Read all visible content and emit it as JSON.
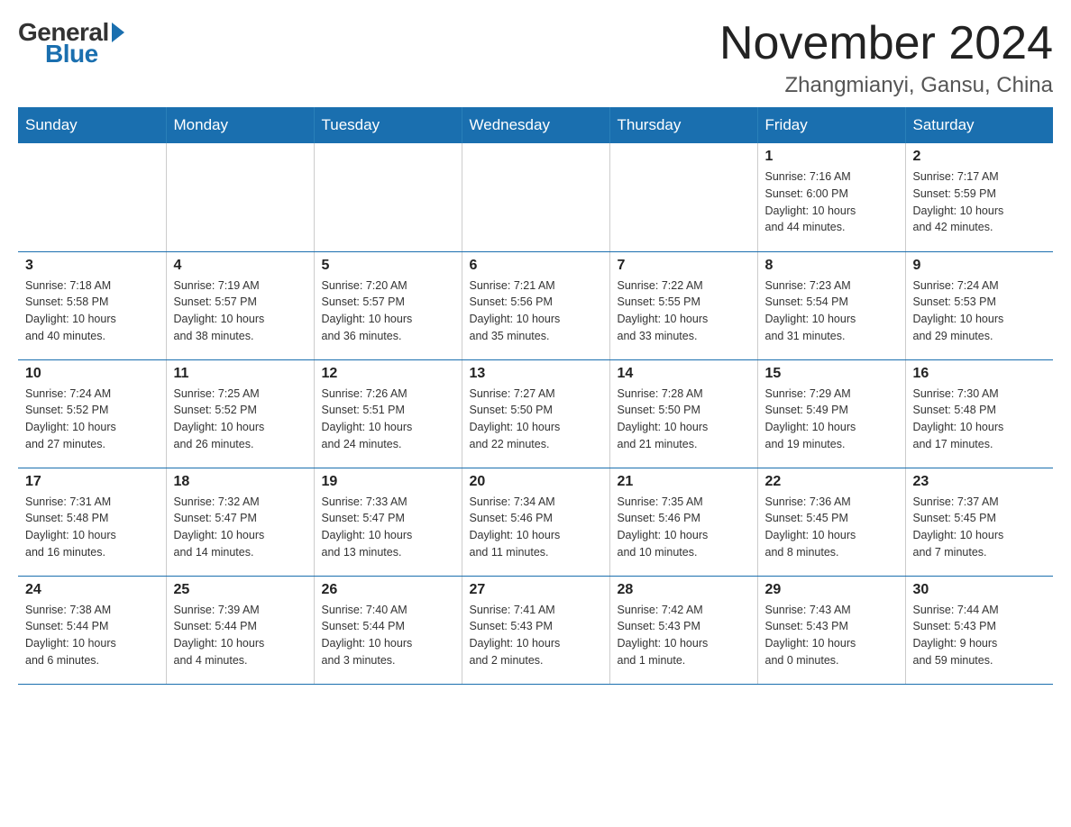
{
  "header": {
    "logo": {
      "general": "General",
      "blue": "Blue",
      "arrow": "▶"
    },
    "title": "November 2024",
    "location": "Zhangmianyi, Gansu, China"
  },
  "weekdays": [
    "Sunday",
    "Monday",
    "Tuesday",
    "Wednesday",
    "Thursday",
    "Friday",
    "Saturday"
  ],
  "weeks": [
    [
      {
        "day": "",
        "info": ""
      },
      {
        "day": "",
        "info": ""
      },
      {
        "day": "",
        "info": ""
      },
      {
        "day": "",
        "info": ""
      },
      {
        "day": "",
        "info": ""
      },
      {
        "day": "1",
        "info": "Sunrise: 7:16 AM\nSunset: 6:00 PM\nDaylight: 10 hours\nand 44 minutes."
      },
      {
        "day": "2",
        "info": "Sunrise: 7:17 AM\nSunset: 5:59 PM\nDaylight: 10 hours\nand 42 minutes."
      }
    ],
    [
      {
        "day": "3",
        "info": "Sunrise: 7:18 AM\nSunset: 5:58 PM\nDaylight: 10 hours\nand 40 minutes."
      },
      {
        "day": "4",
        "info": "Sunrise: 7:19 AM\nSunset: 5:57 PM\nDaylight: 10 hours\nand 38 minutes."
      },
      {
        "day": "5",
        "info": "Sunrise: 7:20 AM\nSunset: 5:57 PM\nDaylight: 10 hours\nand 36 minutes."
      },
      {
        "day": "6",
        "info": "Sunrise: 7:21 AM\nSunset: 5:56 PM\nDaylight: 10 hours\nand 35 minutes."
      },
      {
        "day": "7",
        "info": "Sunrise: 7:22 AM\nSunset: 5:55 PM\nDaylight: 10 hours\nand 33 minutes."
      },
      {
        "day": "8",
        "info": "Sunrise: 7:23 AM\nSunset: 5:54 PM\nDaylight: 10 hours\nand 31 minutes."
      },
      {
        "day": "9",
        "info": "Sunrise: 7:24 AM\nSunset: 5:53 PM\nDaylight: 10 hours\nand 29 minutes."
      }
    ],
    [
      {
        "day": "10",
        "info": "Sunrise: 7:24 AM\nSunset: 5:52 PM\nDaylight: 10 hours\nand 27 minutes."
      },
      {
        "day": "11",
        "info": "Sunrise: 7:25 AM\nSunset: 5:52 PM\nDaylight: 10 hours\nand 26 minutes."
      },
      {
        "day": "12",
        "info": "Sunrise: 7:26 AM\nSunset: 5:51 PM\nDaylight: 10 hours\nand 24 minutes."
      },
      {
        "day": "13",
        "info": "Sunrise: 7:27 AM\nSunset: 5:50 PM\nDaylight: 10 hours\nand 22 minutes."
      },
      {
        "day": "14",
        "info": "Sunrise: 7:28 AM\nSunset: 5:50 PM\nDaylight: 10 hours\nand 21 minutes."
      },
      {
        "day": "15",
        "info": "Sunrise: 7:29 AM\nSunset: 5:49 PM\nDaylight: 10 hours\nand 19 minutes."
      },
      {
        "day": "16",
        "info": "Sunrise: 7:30 AM\nSunset: 5:48 PM\nDaylight: 10 hours\nand 17 minutes."
      }
    ],
    [
      {
        "day": "17",
        "info": "Sunrise: 7:31 AM\nSunset: 5:48 PM\nDaylight: 10 hours\nand 16 minutes."
      },
      {
        "day": "18",
        "info": "Sunrise: 7:32 AM\nSunset: 5:47 PM\nDaylight: 10 hours\nand 14 minutes."
      },
      {
        "day": "19",
        "info": "Sunrise: 7:33 AM\nSunset: 5:47 PM\nDaylight: 10 hours\nand 13 minutes."
      },
      {
        "day": "20",
        "info": "Sunrise: 7:34 AM\nSunset: 5:46 PM\nDaylight: 10 hours\nand 11 minutes."
      },
      {
        "day": "21",
        "info": "Sunrise: 7:35 AM\nSunset: 5:46 PM\nDaylight: 10 hours\nand 10 minutes."
      },
      {
        "day": "22",
        "info": "Sunrise: 7:36 AM\nSunset: 5:45 PM\nDaylight: 10 hours\nand 8 minutes."
      },
      {
        "day": "23",
        "info": "Sunrise: 7:37 AM\nSunset: 5:45 PM\nDaylight: 10 hours\nand 7 minutes."
      }
    ],
    [
      {
        "day": "24",
        "info": "Sunrise: 7:38 AM\nSunset: 5:44 PM\nDaylight: 10 hours\nand 6 minutes."
      },
      {
        "day": "25",
        "info": "Sunrise: 7:39 AM\nSunset: 5:44 PM\nDaylight: 10 hours\nand 4 minutes."
      },
      {
        "day": "26",
        "info": "Sunrise: 7:40 AM\nSunset: 5:44 PM\nDaylight: 10 hours\nand 3 minutes."
      },
      {
        "day": "27",
        "info": "Sunrise: 7:41 AM\nSunset: 5:43 PM\nDaylight: 10 hours\nand 2 minutes."
      },
      {
        "day": "28",
        "info": "Sunrise: 7:42 AM\nSunset: 5:43 PM\nDaylight: 10 hours\nand 1 minute."
      },
      {
        "day": "29",
        "info": "Sunrise: 7:43 AM\nSunset: 5:43 PM\nDaylight: 10 hours\nand 0 minutes."
      },
      {
        "day": "30",
        "info": "Sunrise: 7:44 AM\nSunset: 5:43 PM\nDaylight: 9 hours\nand 59 minutes."
      }
    ]
  ]
}
